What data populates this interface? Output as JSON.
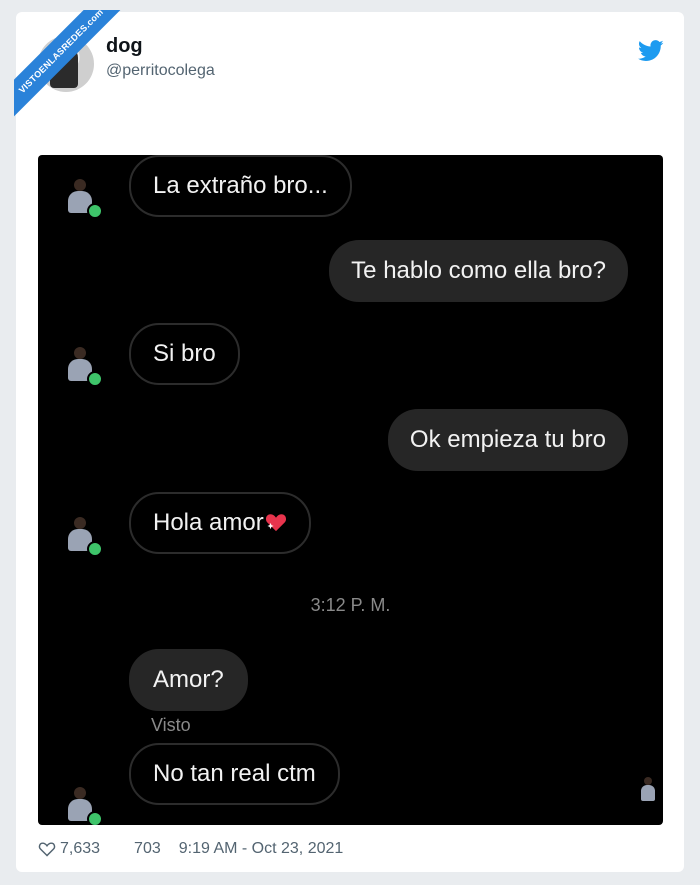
{
  "watermark": {
    "text": "VISTOENLASREDES.com"
  },
  "tweet": {
    "display_name": "dog",
    "handle": "@perritocolega",
    "likes": "7,633",
    "retweets": "703",
    "timestamp": "9:19 AM - Oct 23, 2021"
  },
  "chat": {
    "messages": [
      {
        "side": "in",
        "text": "La extraño bro..."
      },
      {
        "side": "out",
        "text": "Te hablo como ella bro?"
      },
      {
        "side": "in",
        "text": "Si bro"
      },
      {
        "side": "out",
        "text": "Ok empieza tu bro"
      },
      {
        "side": "in",
        "text": "Hola amor",
        "emoji": "sparkling-heart-icon"
      },
      {
        "side": "out",
        "text": "Amor?"
      },
      {
        "side": "in",
        "text": "No tan real ctm"
      }
    ],
    "timestamp": "3:12 P. M.",
    "seen_label": "Visto"
  },
  "colors": {
    "twitter_blue": "#1d9bf0",
    "chat_background": "#000000",
    "bubble_gray": "#262626",
    "online_dot": "#3ec46a"
  }
}
